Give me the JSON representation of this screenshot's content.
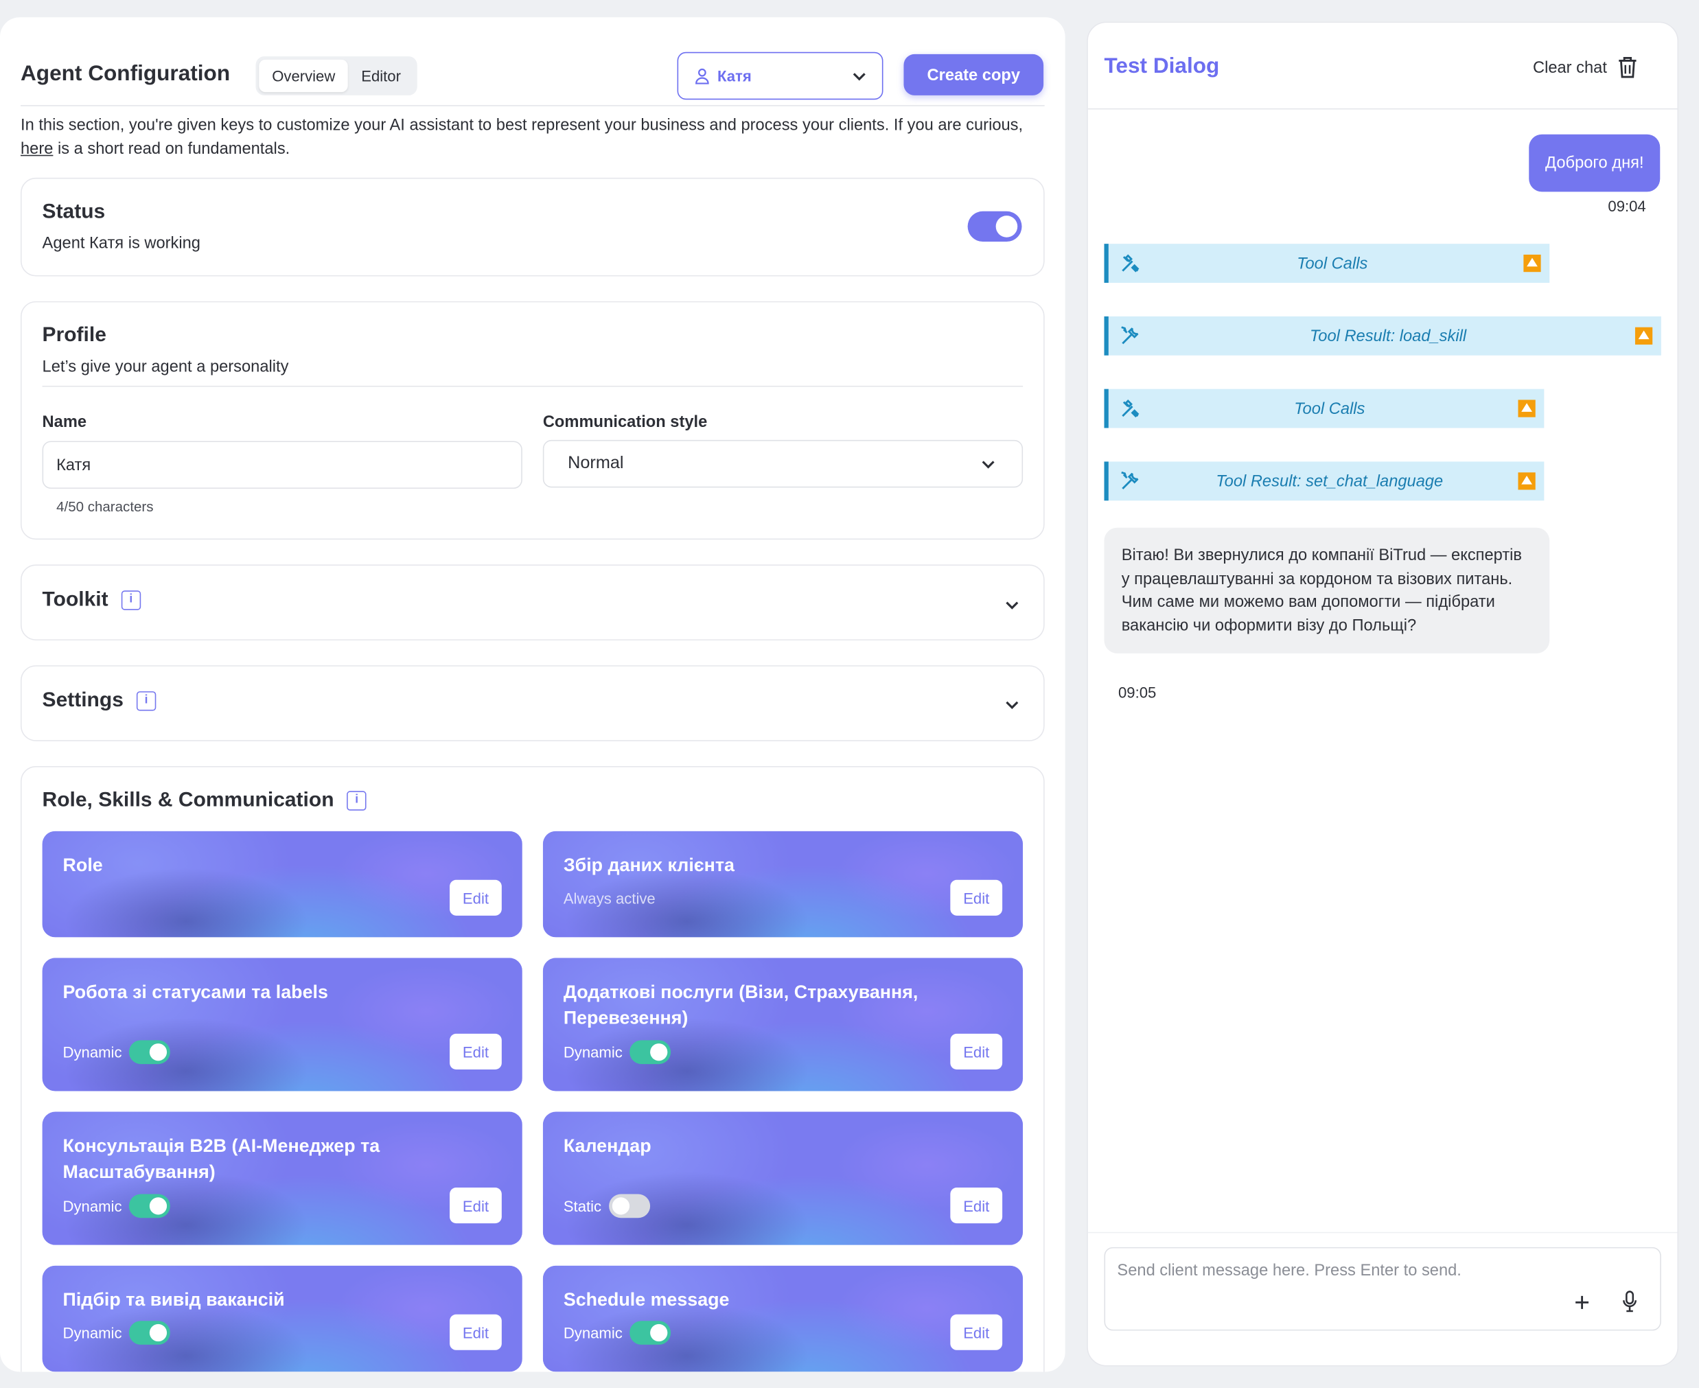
{
  "header": {
    "title": "Agent Configuration",
    "tabs": [
      "Overview",
      "Editor"
    ],
    "active_tab": "Overview",
    "agent_selector": "Катя",
    "create_copy": "Create copy"
  },
  "intro": {
    "before_link": "In this section, you're given keys to customize your AI assistant to best represent your business and process your clients. If you are curious, ",
    "link": "here",
    "after_link": " is a short read on fundamentals."
  },
  "status": {
    "title": "Status",
    "subtitle": "Agent Катя is working",
    "enabled": true
  },
  "profile": {
    "title": "Profile",
    "subtitle": "Let’s give your agent a personality",
    "name_label": "Name",
    "name_value": "Катя",
    "name_hint": "4/50 characters",
    "style_label": "Communication style",
    "style_value": "Normal"
  },
  "toolkit": {
    "title": "Toolkit"
  },
  "settings": {
    "title": "Settings"
  },
  "skills": {
    "title": "Role, Skills & Communication",
    "edit_label": "Edit",
    "items": [
      {
        "title": "Role",
        "mode": "",
        "enabled": null
      },
      {
        "title": "Збір даних клієнта",
        "mode": "Always active",
        "enabled": null
      },
      {
        "title": "Робота зі статусами та labels",
        "mode": "Dynamic",
        "enabled": true
      },
      {
        "title": "Додаткові послуги (Візи, Страхування, Перевезення)",
        "mode": "Dynamic",
        "enabled": true
      },
      {
        "title": "Консультація B2B (AI-Менеджер та Масштабування)",
        "mode": "Dynamic",
        "enabled": true
      },
      {
        "title": "Календар",
        "mode": "Static",
        "enabled": false
      },
      {
        "title": "Підбір та вивід вакансій",
        "mode": "Dynamic",
        "enabled": true
      },
      {
        "title": "Schedule message",
        "mode": "Dynamic",
        "enabled": true
      }
    ]
  },
  "dialog": {
    "title": "Test Dialog",
    "clear_chat": "Clear chat",
    "messages": {
      "user_text": "Доброго дня!",
      "user_time": "09:04",
      "tool_1": "Tool Calls",
      "tool_2": "Tool Result: load_skill",
      "tool_3": "Tool Calls",
      "tool_4": "Tool Result: set_chat_language",
      "bot_text": "Вітаю! Ви звернулися до компанії BiTrud — експертів у працевлаштуванні за кордоном та візових питань. Чим саме ми можемо вам допомогти — підібрати вакансію чи оформити візу до Польщі?",
      "bot_time": "09:05"
    },
    "composer_placeholder": "Send client message here. Press Enter to send."
  },
  "colors": {
    "accent": "#7476EF",
    "tool_bg": "#D3EEFA",
    "tool_accent": "#1C8CC0",
    "toggle_on": "#3CC4A0",
    "warn": "#F59E0B"
  }
}
